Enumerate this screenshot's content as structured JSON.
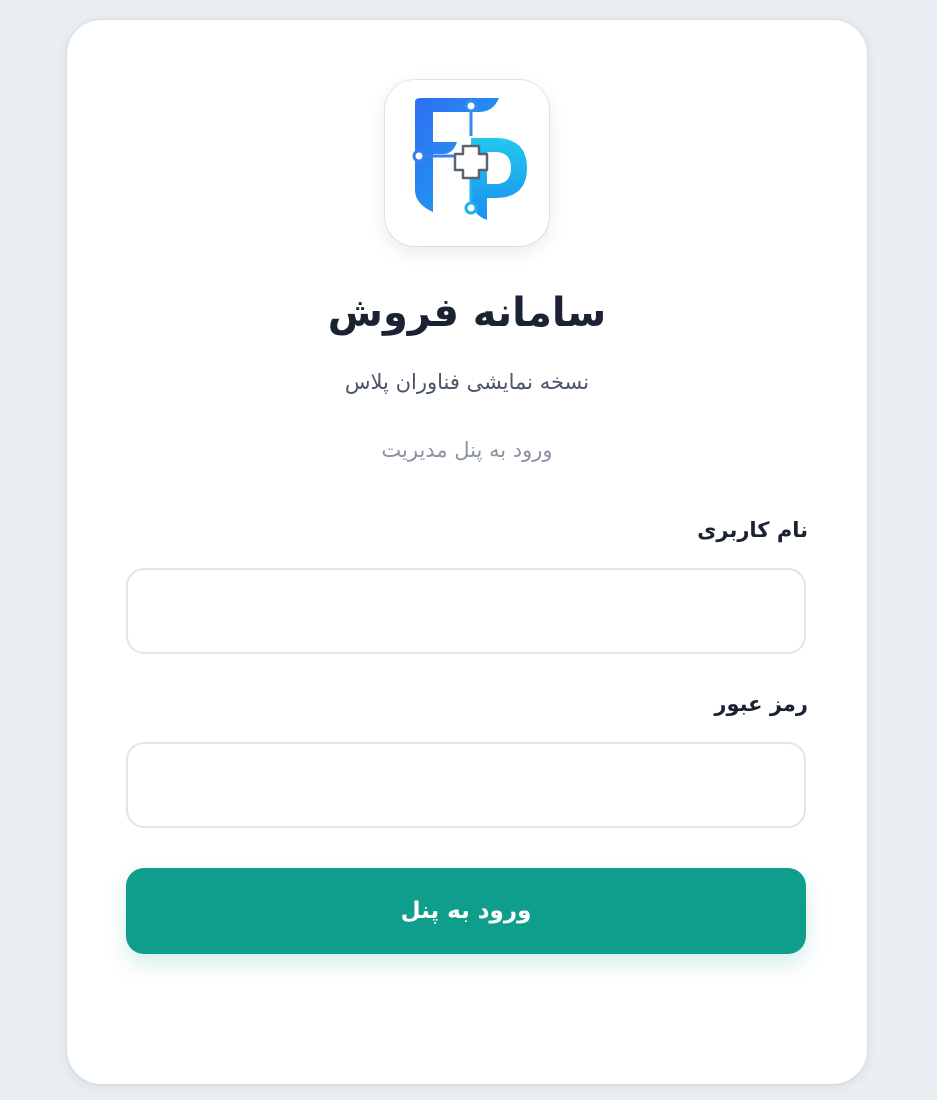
{
  "app": {
    "title": "سامانه فروش",
    "subtitle": "نسخه نمایشی فناوران پلاس",
    "hint": "ورود به پنل مدیریت",
    "logo_letters": "FP"
  },
  "form": {
    "username_label": "نام کاربری",
    "username_value": "",
    "password_label": "رمز عبور",
    "password_value": "",
    "submit_label": "ورود به پنل"
  },
  "colors": {
    "background": "#e9eef2",
    "card": "#ffffff",
    "primary": "#0f9e8b",
    "title_text": "#1a2233",
    "logo_blue": "#1e6ff0",
    "logo_cyan": "#1fc7ea"
  },
  "icons": {
    "logo": "fp-medical-cross-logo"
  }
}
